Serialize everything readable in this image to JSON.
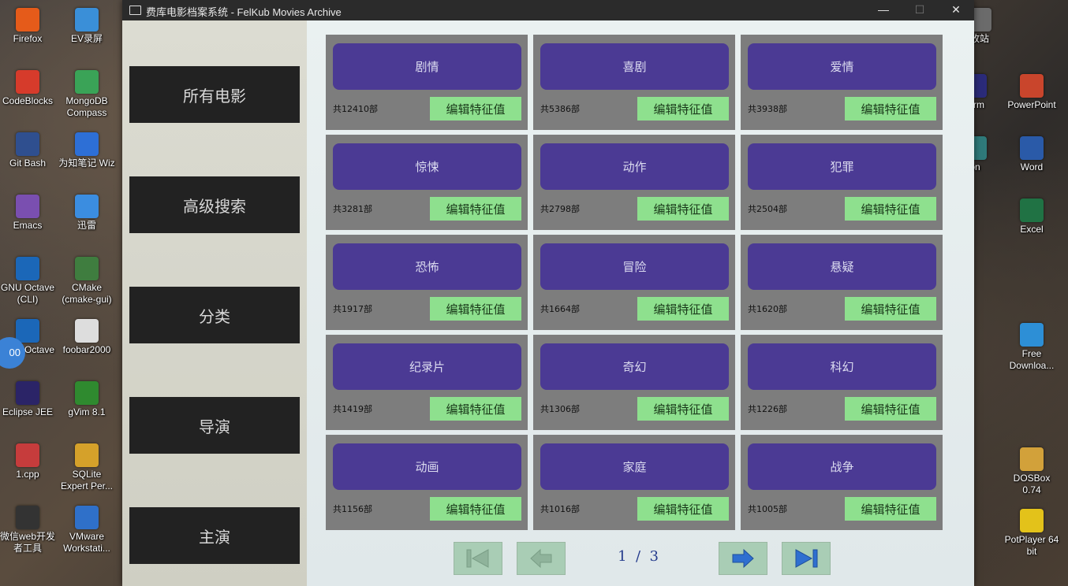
{
  "desktop": {
    "left_icons": [
      {
        "label": "Firefox",
        "color": "#e55b1a"
      },
      {
        "label": "EV录屏",
        "color": "#3a8fd8"
      },
      {
        "label": "CodeBlocks",
        "color": "#d63b2b"
      },
      {
        "label": "MongoDB Compass",
        "color": "#3aa357"
      },
      {
        "label": "Git Bash",
        "color": "#2f4f8f"
      },
      {
        "label": "为知笔记 Wiz",
        "color": "#2d6fd6"
      },
      {
        "label": "Emacs",
        "color": "#7a4fb0"
      },
      {
        "label": "迅雷",
        "color": "#3b8de0"
      },
      {
        "label": "GNU Octave (CLI)",
        "color": "#1b67b8"
      },
      {
        "label": "CMake (cmake-gui)",
        "color": "#3f7d3f"
      },
      {
        "label": "GNU Octave",
        "color": "#1b67b8"
      },
      {
        "label": "foobar2000",
        "color": "#dddddd"
      },
      {
        "label": "Eclipse JEE",
        "color": "#2b2467"
      },
      {
        "label": "gVim 8.1",
        "color": "#2f8a2f"
      },
      {
        "label": "1.cpp",
        "color": "#c63c3c"
      },
      {
        "label": "SQLite Expert Per...",
        "color": "#d5a12a"
      },
      {
        "label": "微信web开发者工具",
        "color": "#333333"
      },
      {
        "label": "VMware Workstati...",
        "color": "#2f70c9"
      }
    ],
    "right_icons": [
      {
        "label": "收站",
        "color": "#6b6b6b"
      },
      {
        "label": "torm",
        "color": "#2b2b7a"
      },
      {
        "label": "PowerPoint",
        "color": "#c9452c"
      },
      {
        "label": "on",
        "color": "#2f7a7a"
      },
      {
        "label": "Word",
        "color": "#2a5aa8"
      },
      {
        "label": "Excel",
        "color": "#207244"
      },
      {
        "label": "Free Downloa...",
        "color": "#2d8fd6"
      },
      {
        "label": "DOSBox 0.74",
        "color": "#d2a13a"
      },
      {
        "label": "PotPlayer 64 bit",
        "color": "#e3c21a"
      }
    ],
    "clock_fragment": "00"
  },
  "window": {
    "title": "费库电影档案系统 - FelKub Movies Archive",
    "minimize": "—",
    "maximize": "☐",
    "close": "✕"
  },
  "sidebar": {
    "items": [
      {
        "label": "所有电影"
      },
      {
        "label": "高级搜索"
      },
      {
        "label": "分类"
      },
      {
        "label": "导演"
      },
      {
        "label": "主演"
      }
    ]
  },
  "genres": [
    {
      "name": "剧情",
      "count": "共12410部",
      "edit": "编辑特征值"
    },
    {
      "name": "喜剧",
      "count": "共5386部",
      "edit": "编辑特征值"
    },
    {
      "name": "爱情",
      "count": "共3938部",
      "edit": "编辑特征值"
    },
    {
      "name": "惊悚",
      "count": "共3281部",
      "edit": "编辑特征值"
    },
    {
      "name": "动作",
      "count": "共2798部",
      "edit": "编辑特征值"
    },
    {
      "name": "犯罪",
      "count": "共2504部",
      "edit": "编辑特征值"
    },
    {
      "name": "恐怖",
      "count": "共1917部",
      "edit": "编辑特征值"
    },
    {
      "name": "冒险",
      "count": "共1664部",
      "edit": "编辑特征值"
    },
    {
      "name": "悬疑",
      "count": "共1620部",
      "edit": "编辑特征值"
    },
    {
      "name": "纪录片",
      "count": "共1419部",
      "edit": "编辑特征值"
    },
    {
      "name": "奇幻",
      "count": "共1306部",
      "edit": "编辑特征值"
    },
    {
      "name": "科幻",
      "count": "共1226部",
      "edit": "编辑特征值"
    },
    {
      "name": "动画",
      "count": "共1156部",
      "edit": "编辑特征值"
    },
    {
      "name": "家庭",
      "count": "共1016部",
      "edit": "编辑特征值"
    },
    {
      "name": "战争",
      "count": "共1005部",
      "edit": "编辑特征值"
    }
  ],
  "pagination": {
    "current": 1,
    "total": 3,
    "indicator": "1  /  3"
  },
  "colors": {
    "genre_button": "#4b3a94",
    "edit_button": "#8ee08e",
    "card_bg": "#7d7d7d",
    "sidebar_button": "#222222",
    "pager_button": "#a9cdb5"
  }
}
